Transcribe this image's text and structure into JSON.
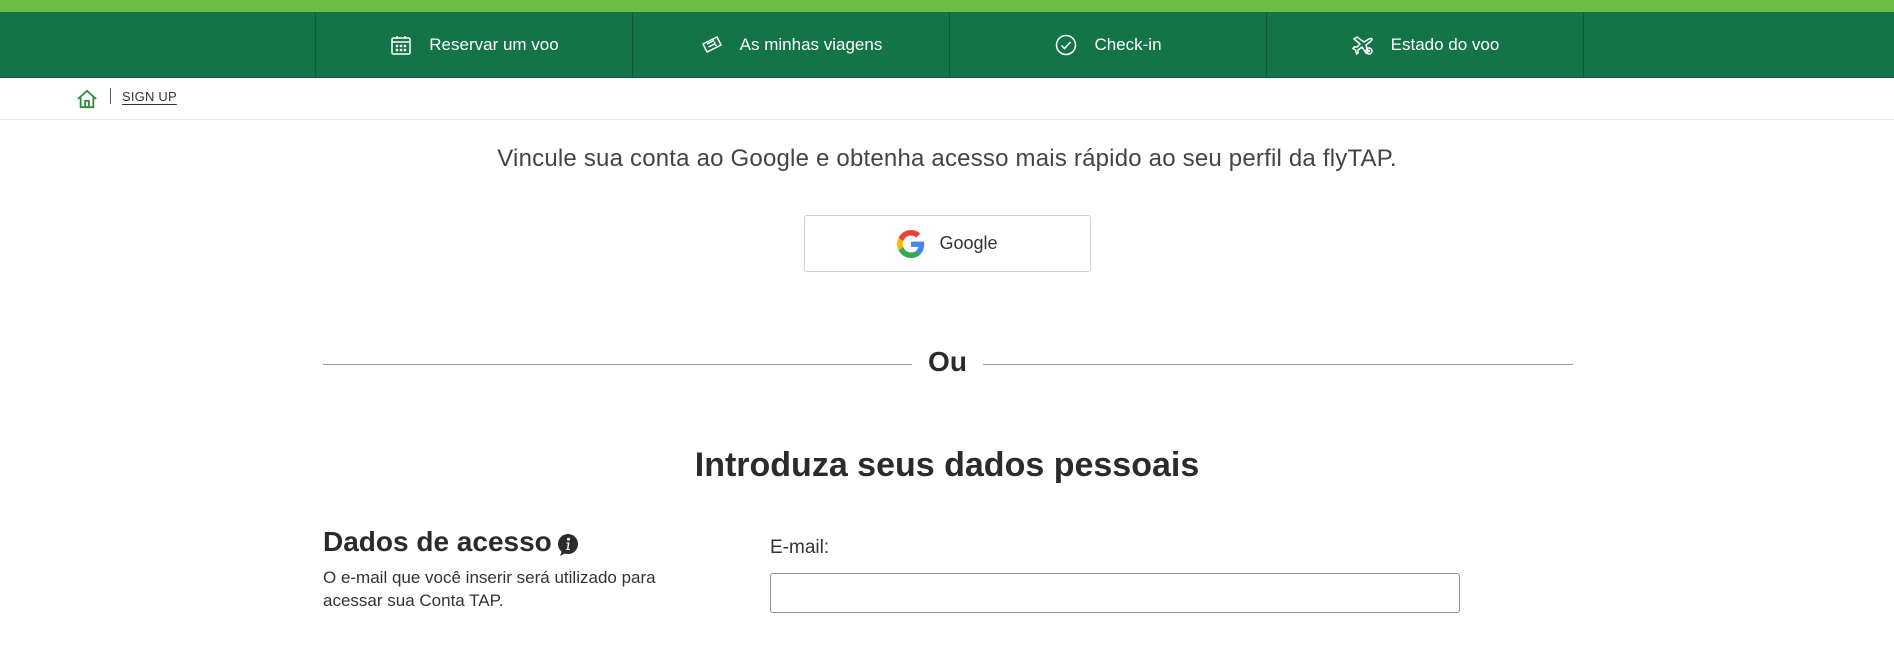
{
  "nav": {
    "items": [
      {
        "label": "Reservar um voo",
        "icon": "calendar-icon"
      },
      {
        "label": "As minhas viagens",
        "icon": "ticket-icon"
      },
      {
        "label": "Check-in",
        "icon": "check-circle-icon"
      },
      {
        "label": "Estado do voo",
        "icon": "flight-status-icon"
      }
    ]
  },
  "breadcrumb": {
    "home_icon": "home-icon",
    "current": "SIGN UP"
  },
  "google_section": {
    "intro": "Vincule sua conta ao Google e obtenha acesso mais rápido ao seu perfil da flyTAP.",
    "button_label": "Google"
  },
  "divider": {
    "label": "Ou"
  },
  "form": {
    "title": "Introduza seus dados pessoais",
    "access": {
      "heading": "Dados de acesso",
      "description": "O e-mail que você inserir será utilizado para acessar sua Conta TAP.",
      "info_icon": "info-icon"
    },
    "email": {
      "label": "E-mail:",
      "value": "",
      "placeholder": ""
    }
  },
  "colors": {
    "nav_bg": "#137448",
    "stripe": "#6cbd45",
    "text": "#2b2b2b",
    "home_icon": "#2e8b3e"
  }
}
